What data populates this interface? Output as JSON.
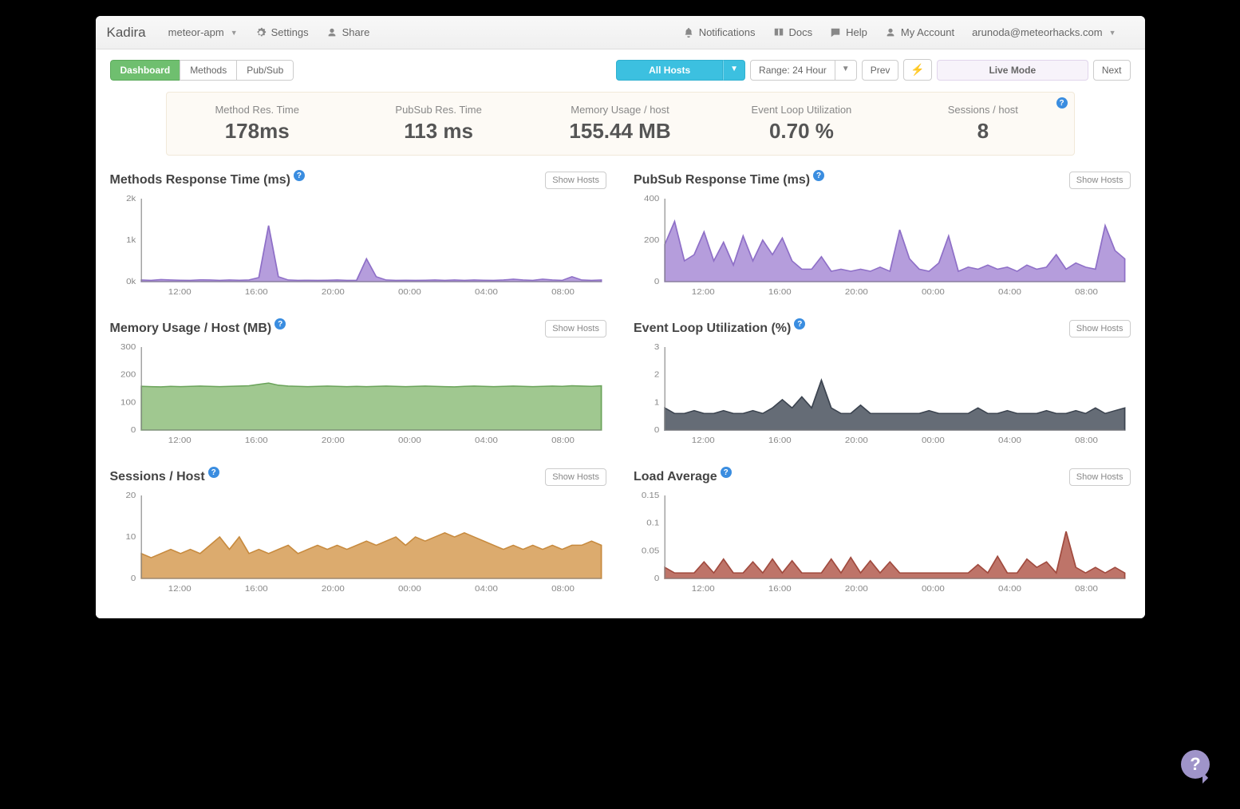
{
  "brand": "Kadira",
  "topbar": {
    "app_selector": "meteor-apm",
    "settings": "Settings",
    "share": "Share",
    "notifications": "Notifications",
    "docs": "Docs",
    "help": "Help",
    "account": "My Account",
    "user": "arunoda@meteorhacks.com"
  },
  "tabs": {
    "dashboard": "Dashboard",
    "methods": "Methods",
    "pubsub": "Pub/Sub"
  },
  "controls": {
    "all_hosts": "All Hosts",
    "range": "Range: 24 Hour",
    "prev": "Prev",
    "live_mode": "Live Mode",
    "next": "Next"
  },
  "summary": [
    {
      "label": "Method Res. Time",
      "value": "178ms"
    },
    {
      "label": "PubSub Res. Time",
      "value": "113 ms"
    },
    {
      "label": "Memory Usage / host",
      "value": "155.44 MB"
    },
    {
      "label": "Event Loop Utilization",
      "value": "0.70 %"
    },
    {
      "label": "Sessions / host",
      "value": "8"
    }
  ],
  "show_hosts_label": "Show Hosts",
  "x_ticks": [
    "12:00",
    "16:00",
    "20:00",
    "00:00",
    "04:00",
    "08:00"
  ],
  "charts": [
    {
      "title": "Methods Response Time (ms)",
      "ylabels": [
        "2k",
        "1k",
        "0k"
      ],
      "color": "#8e6fc7",
      "fill": "#a88cd6"
    },
    {
      "title": "PubSub Response Time (ms)",
      "ylabels": [
        "400",
        "200",
        "0"
      ],
      "color": "#8e6fc7",
      "fill": "#a88cd6"
    },
    {
      "title": "Memory Usage / Host (MB)",
      "ylabels": [
        "300",
        "200",
        "100",
        "0"
      ],
      "color": "#6aa35a",
      "fill": "#8fbe7d"
    },
    {
      "title": "Event Loop Utilization (%)",
      "ylabels": [
        "3",
        "2",
        "1",
        "0"
      ],
      "color": "#3c4450",
      "fill": "#4a525e"
    },
    {
      "title": "Sessions / Host",
      "ylabels": [
        "20",
        "10",
        "0"
      ],
      "color": "#c78a3e",
      "fill": "#d69c55"
    },
    {
      "title": "Load Average",
      "ylabels": [
        "0.15",
        "0.1",
        "0.05",
        "0"
      ],
      "color": "#a04a3e",
      "fill": "#b35c4f"
    }
  ],
  "chart_data": [
    {
      "type": "area",
      "title": "Methods Response Time (ms)",
      "xlabel": "",
      "ylabel": "ms",
      "ylim": [
        0,
        2000
      ],
      "x_ticks": [
        "12:00",
        "16:00",
        "20:00",
        "00:00",
        "04:00",
        "08:00"
      ],
      "values": [
        40,
        30,
        50,
        40,
        35,
        30,
        45,
        40,
        30,
        40,
        35,
        40,
        100,
        1350,
        120,
        40,
        30,
        35,
        30,
        35,
        40,
        30,
        35,
        550,
        120,
        40,
        30,
        35,
        30,
        35,
        40,
        30,
        40,
        30,
        40,
        35,
        30,
        40,
        60,
        40,
        30,
        60,
        40,
        30,
        120,
        40,
        30,
        40
      ]
    },
    {
      "type": "area",
      "title": "PubSub Response Time (ms)",
      "xlabel": "",
      "ylabel": "ms",
      "ylim": [
        0,
        400
      ],
      "x_ticks": [
        "12:00",
        "16:00",
        "20:00",
        "00:00",
        "04:00",
        "08:00"
      ],
      "values": [
        180,
        290,
        100,
        130,
        240,
        100,
        190,
        80,
        220,
        100,
        200,
        130,
        210,
        100,
        60,
        60,
        120,
        50,
        60,
        50,
        60,
        50,
        70,
        50,
        250,
        110,
        60,
        50,
        90,
        220,
        50,
        70,
        60,
        80,
        60,
        70,
        50,
        80,
        60,
        70,
        130,
        60,
        90,
        70,
        60,
        270,
        150,
        110
      ]
    },
    {
      "type": "area",
      "title": "Memory Usage / Host (MB)",
      "xlabel": "",
      "ylabel": "MB",
      "ylim": [
        0,
        300
      ],
      "x_ticks": [
        "12:00",
        "16:00",
        "20:00",
        "00:00",
        "04:00",
        "08:00"
      ],
      "values": [
        158,
        157,
        156,
        158,
        157,
        158,
        159,
        158,
        157,
        158,
        159,
        160,
        165,
        170,
        162,
        159,
        158,
        157,
        158,
        159,
        158,
        157,
        158,
        157,
        158,
        159,
        158,
        157,
        158,
        159,
        158,
        157,
        156,
        158,
        159,
        158,
        157,
        158,
        159,
        158,
        157,
        158,
        159,
        158,
        160,
        159,
        158,
        160
      ]
    },
    {
      "type": "area",
      "title": "Event Loop Utilization (%)",
      "xlabel": "",
      "ylabel": "%",
      "ylim": [
        0,
        3
      ],
      "x_ticks": [
        "12:00",
        "16:00",
        "20:00",
        "00:00",
        "04:00",
        "08:00"
      ],
      "values": [
        0.8,
        0.6,
        0.6,
        0.7,
        0.6,
        0.6,
        0.7,
        0.6,
        0.6,
        0.7,
        0.6,
        0.8,
        1.1,
        0.8,
        1.2,
        0.8,
        1.8,
        0.8,
        0.6,
        0.6,
        0.9,
        0.6,
        0.6,
        0.6,
        0.6,
        0.6,
        0.6,
        0.7,
        0.6,
        0.6,
        0.6,
        0.6,
        0.8,
        0.6,
        0.6,
        0.7,
        0.6,
        0.6,
        0.6,
        0.7,
        0.6,
        0.6,
        0.7,
        0.6,
        0.8,
        0.6,
        0.7,
        0.8
      ]
    },
    {
      "type": "area",
      "title": "Sessions / Host",
      "xlabel": "",
      "ylabel": "sessions",
      "ylim": [
        0,
        20
      ],
      "x_ticks": [
        "12:00",
        "16:00",
        "20:00",
        "00:00",
        "04:00",
        "08:00"
      ],
      "values": [
        6,
        5,
        6,
        7,
        6,
        7,
        6,
        8,
        10,
        7,
        10,
        6,
        7,
        6,
        7,
        8,
        6,
        7,
        8,
        7,
        8,
        7,
        8,
        9,
        8,
        9,
        10,
        8,
        10,
        9,
        10,
        11,
        10,
        11,
        10,
        9,
        8,
        7,
        8,
        7,
        8,
        7,
        8,
        7,
        8,
        8,
        9,
        8
      ]
    },
    {
      "type": "area",
      "title": "Load Average",
      "xlabel": "",
      "ylabel": "",
      "ylim": [
        0,
        0.15
      ],
      "x_ticks": [
        "12:00",
        "16:00",
        "20:00",
        "00:00",
        "04:00",
        "08:00"
      ],
      "values": [
        0.02,
        0.01,
        0.01,
        0.01,
        0.03,
        0.01,
        0.035,
        0.01,
        0.01,
        0.03,
        0.01,
        0.035,
        0.01,
        0.032,
        0.01,
        0.01,
        0.01,
        0.035,
        0.01,
        0.038,
        0.01,
        0.032,
        0.01,
        0.03,
        0.01,
        0.01,
        0.01,
        0.01,
        0.01,
        0.01,
        0.01,
        0.01,
        0.025,
        0.01,
        0.04,
        0.01,
        0.01,
        0.035,
        0.02,
        0.03,
        0.01,
        0.085,
        0.02,
        0.01,
        0.02,
        0.01,
        0.02,
        0.01
      ]
    }
  ]
}
